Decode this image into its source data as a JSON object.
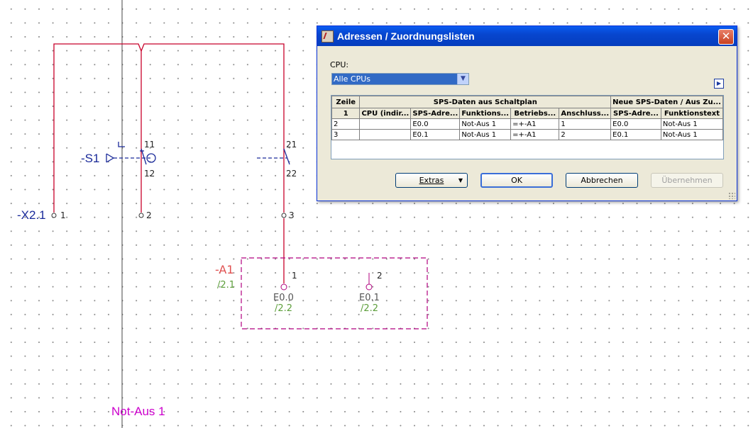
{
  "schematic": {
    "s1_label": "-S1",
    "s1_contact1_top": "11",
    "s1_contact1_bottom": "12",
    "s1_contact2_top": "21",
    "s1_contact2_bottom": "22",
    "x21_label": "-X2.1",
    "terminals": [
      "1",
      "2",
      "3"
    ],
    "a1_label": "-A1",
    "a1_ref": "/2.1",
    "a1_pins": [
      {
        "pin": "1",
        "address": "E0.0",
        "ref": "/2.2"
      },
      {
        "pin": "2",
        "address": "E0.1",
        "ref": "/2.2"
      }
    ],
    "bottom_label": "Not-Aus 1",
    "colors": {
      "wire": "#c8002a",
      "device": "#1a2a9a",
      "plc_box": "#b0007f",
      "ref_text": "#5c9e3a",
      "label_magenta": "#cc00cc"
    }
  },
  "dialog": {
    "title": "Adressen / Zuordnungslisten",
    "close_icon": "close-icon",
    "cpu_label": "CPU:",
    "cpu_value": "Alle CPUs",
    "table": {
      "group_headers": {
        "row": "Zeile",
        "sps": "SPS-Daten aus Schaltplan",
        "neu": "Neue SPS-Daten / Aus Zu..."
      },
      "columns": [
        "1",
        "CPU (indir...",
        "SPS-Adre...",
        "Funktions...",
        "Betriebs...",
        "Anschluss...",
        "SPS-Adre...",
        "Funktionstext"
      ],
      "rows": [
        [
          "2",
          "",
          "E0.0",
          "Not-Aus 1",
          "=+-A1",
          "1",
          "E0.0",
          "Not-Aus 1"
        ],
        [
          "3",
          "",
          "E0.1",
          "Not-Aus 1",
          "=+-A1",
          "2",
          "E0.1",
          "Not-Aus 1"
        ]
      ]
    },
    "buttons": {
      "extras": "Extras",
      "ok": "OK",
      "cancel": "Abbrechen",
      "apply": "Übernehmen"
    }
  }
}
